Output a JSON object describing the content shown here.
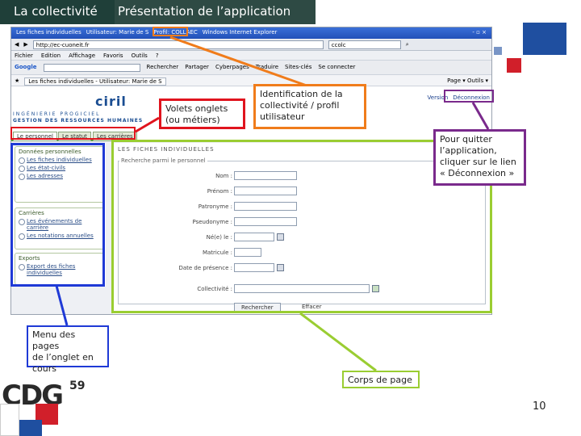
{
  "header": {
    "section": "La collectivité",
    "title": "Présentation de l’application"
  },
  "browser": {
    "title_left": "Les fiches individuelles",
    "title_user": "Utilisateur: Marie de S",
    "title_profile": "Profil: COLLAEC",
    "title_right": "Windows Internet Explorer",
    "window_controls": "- ▫ ×",
    "address": "http://ec-cuoneit.fr",
    "search": "ccolc",
    "menu": [
      "Fichier",
      "Edition",
      "Affichage",
      "Favoris",
      "Outils",
      "?"
    ],
    "google_items": [
      "Rechercher",
      "Partager",
      "Cyberpages",
      "Traduire",
      "Sites-clés",
      "Se connecter"
    ],
    "tab_label": "Les fiches individuelles - Utilisateur: Marie de S",
    "tab_right": "Page ▾  Outils ▾"
  },
  "app": {
    "logo": "ciril",
    "logo_line1": "INGÉNIERIE PROGICIEL",
    "logo_line2": "GESTION DES RESSOURCES HUMAINES",
    "links": [
      "Version",
      "Déconnexion"
    ],
    "tabs": [
      "Le personnel",
      "Le statut",
      "Les carrières"
    ],
    "sidebar": [
      {
        "title": "Données personnelles",
        "items": [
          "Les fiches individuelles",
          "Les état-civils",
          "Les adresses"
        ]
      },
      {
        "title": "Carrières",
        "items": [
          "Les événements de carrière",
          "Les notations annuelles"
        ]
      },
      {
        "title": "Exports",
        "items": [
          "Export des fiches individuelles"
        ]
      }
    ],
    "section_title": "LES FICHES INDIVIDUELLES",
    "fieldset_legend": "Recherche parmi le personnel",
    "fields": [
      "Nom :",
      "Prénom :",
      "Patronyme :",
      "Pseudonyme :",
      "Né(e) le :",
      "Matricule :",
      "Date de présence :",
      "Collectivité :"
    ],
    "buttons": {
      "search": "Rechercher",
      "clear": "Effacer"
    }
  },
  "callouts": {
    "tabs": "Volets onglets\n(ou métiers)",
    "user": "Identification de la\ncollectivité / profil\nutilisateur",
    "logout": "Pour quitter\nl’application,\ncliquer sur le lien\n« Déconnexion »",
    "menu": "Menu des pages\nde l’onglet en\ncours",
    "body": "Corps de page"
  },
  "colors": {
    "orange": "#f07c1b",
    "red": "#e0141e",
    "blue": "#1f3ad6",
    "purple": "#7a2a8c",
    "green": "#9acd32",
    "header_dark": "#1f3f39",
    "brand_blue": "#1f4fa0",
    "brand_red": "#d11f2a"
  },
  "footer": {
    "logo": "CDG",
    "logo_sup": "59",
    "page_number": "10"
  }
}
